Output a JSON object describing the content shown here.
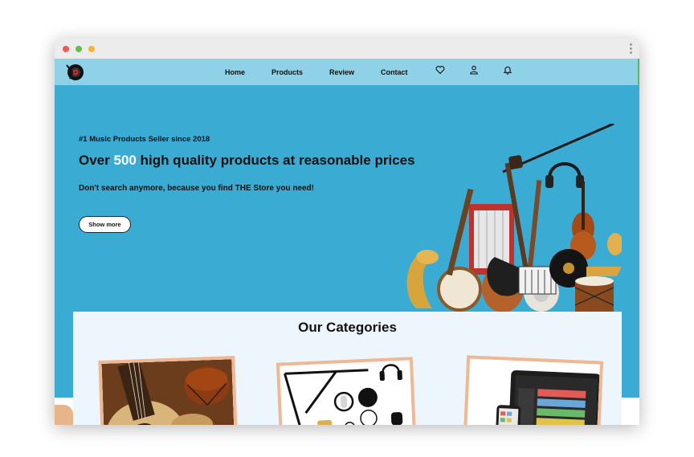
{
  "nav": {
    "links": [
      "Home",
      "Products",
      "Review",
      "Contact"
    ],
    "icons": [
      "heart-icon",
      "user-icon",
      "bell-icon"
    ]
  },
  "hero": {
    "tagline": "#1 Music Products Seller since 2018",
    "title_before": "Over ",
    "title_highlight": "500",
    "title_after": " high quality products at reasonable prices",
    "subtitle": "Don't search anymore, because you find THE Store you need!",
    "button_label": "Show more"
  },
  "categories": {
    "title": "Our Categories"
  },
  "colors": {
    "navbar": "#8fd1e6",
    "hero": "#3aabd3",
    "highlight": "#ffffff",
    "card_border": "#efb793",
    "section_bg": "#eef6fd"
  }
}
